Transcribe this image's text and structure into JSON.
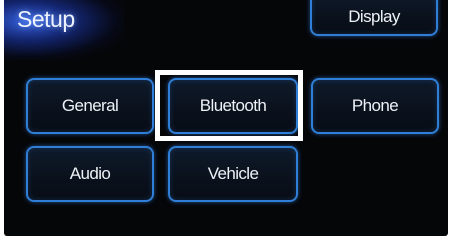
{
  "screen": {
    "title": "Setup"
  },
  "buttons": {
    "display": "Display",
    "general": "General",
    "bluetooth": "Bluetooth",
    "phone": "Phone",
    "audio": "Audio",
    "vehicle": "Vehicle"
  },
  "highlighted_button": "Bluetooth",
  "colors": {
    "screen_background": "#050608",
    "button_border": "#2f7fd6",
    "button_text": "#eef1f6",
    "highlight": "#ffffff",
    "title_glow": "#3c6eff"
  }
}
